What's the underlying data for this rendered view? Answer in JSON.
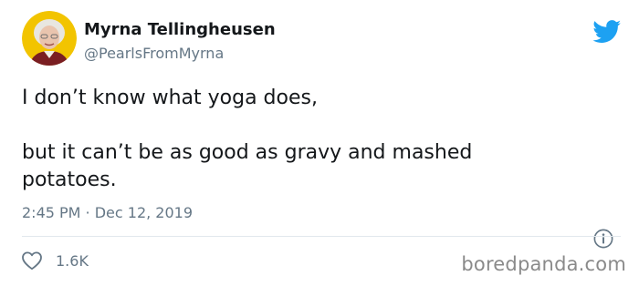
{
  "author": {
    "name": "Myrna Tellingheusen",
    "handle": "@PearlsFromMyrna",
    "avatar_icon": "avatar-photo"
  },
  "brand_icon": "twitter-bird-icon",
  "tweet": {
    "line1": "I don’t know what yoga does,",
    "line2": "but it can’t be as good as gravy and mashed",
    "line3": "potatoes.",
    "timestamp": "2:45 PM · Dec 12, 2019"
  },
  "actions": {
    "like_count": "1.6K",
    "like_icon": "heart-icon",
    "info_icon": "info-icon"
  },
  "watermark": "boredpanda.com",
  "colors": {
    "accent": "#1da1f2",
    "secondary_text": "#657786",
    "avatar_background": "#f2c400"
  }
}
